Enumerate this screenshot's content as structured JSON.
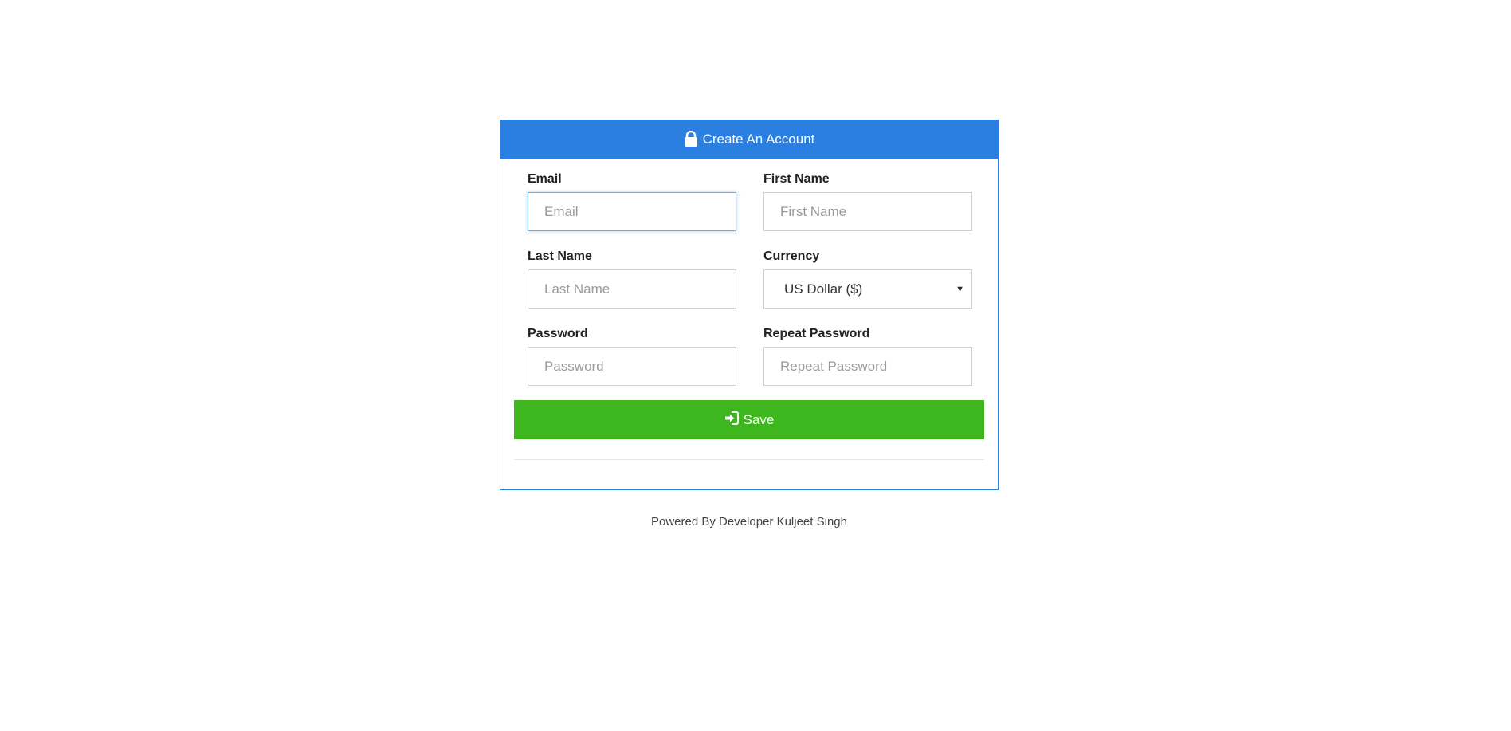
{
  "panel": {
    "title": "Create An Account",
    "icon": "lock-icon"
  },
  "form": {
    "email": {
      "label": "Email",
      "placeholder": "Email",
      "value": ""
    },
    "first_name": {
      "label": "First Name",
      "placeholder": "First Name",
      "value": ""
    },
    "last_name": {
      "label": "Last Name",
      "placeholder": "Last Name",
      "value": ""
    },
    "currency": {
      "label": "Currency",
      "selected": "US Dollar ($)"
    },
    "password": {
      "label": "Password",
      "placeholder": "Password",
      "value": ""
    },
    "repeat_password": {
      "label": "Repeat Password",
      "placeholder": "Repeat Password",
      "value": ""
    },
    "save_label": "Save",
    "save_icon": "sign-in-icon"
  },
  "footer": {
    "text": "Powered By Developer Kuljeet Singh"
  },
  "colors": {
    "primary": "#2a7fe0",
    "success": "#3db71d",
    "focus_border": "#66afe9"
  }
}
